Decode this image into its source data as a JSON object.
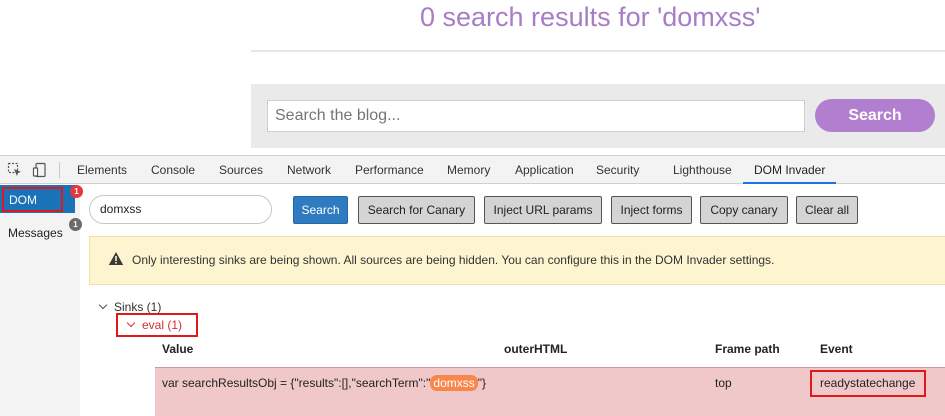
{
  "page": {
    "title": "0 search results for 'domxss'",
    "search_placeholder": "Search the blog...",
    "search_button": "Search"
  },
  "devtools": {
    "tabs": [
      "Elements",
      "Console",
      "Sources",
      "Network",
      "Performance",
      "Memory",
      "Application",
      "Security",
      "Lighthouse",
      "DOM Invader"
    ],
    "active_tab": "DOM Invader",
    "side": {
      "dom_label": "DOM",
      "dom_badge": "1",
      "messages_label": "Messages",
      "messages_badge": "1"
    },
    "toolbar": {
      "canary_value": "domxss",
      "search": "Search",
      "search_canary": "Search for Canary",
      "inject_url": "Inject URL params",
      "inject_forms": "Inject forms",
      "copy_canary": "Copy canary",
      "clear_all": "Clear all"
    },
    "warning": "Only interesting sinks are being shown. All sources are being hidden. You can configure this in the DOM Invader settings.",
    "tree": {
      "sinks_label": "Sinks (1)",
      "eval_label": "eval (1)"
    },
    "table": {
      "headers": [
        "Value",
        "outerHTML",
        "Frame path",
        "Event"
      ],
      "row": {
        "value_prefix": "var searchResultsObj = {\"results\":[],\"searchTerm\":\"",
        "value_highlight": "domxss",
        "value_suffix": "\"}",
        "outer_html": "",
        "frame_path": "top",
        "event": "readystatechange"
      }
    },
    "colors": {
      "accent": "#1a73e8",
      "badge_red": "#e0393e",
      "badge_gray": "#6b6b6b",
      "highlight": "#f7874b",
      "row_bg": "#f0c8ca"
    }
  }
}
